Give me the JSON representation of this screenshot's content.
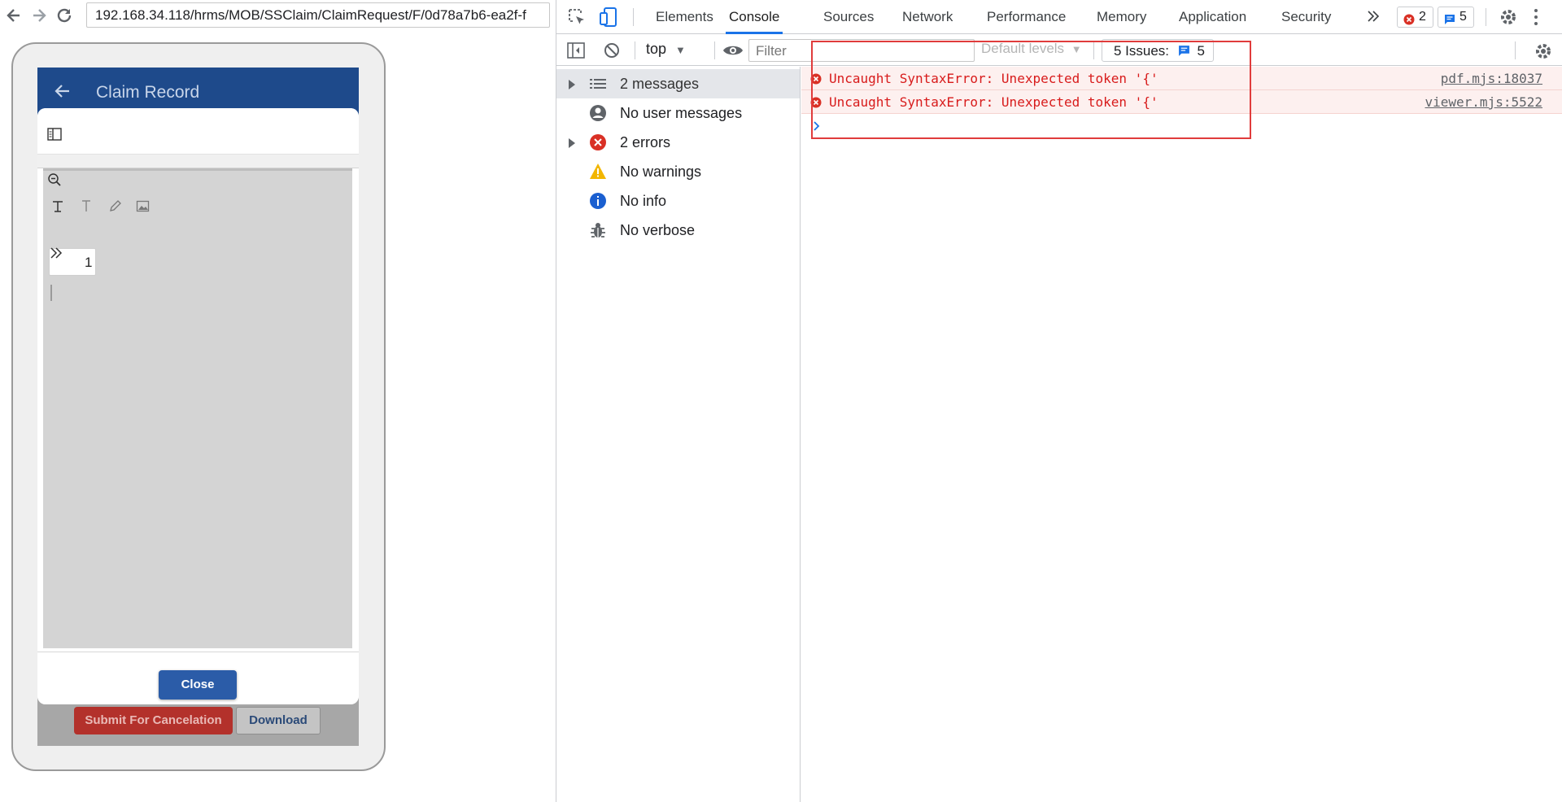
{
  "browser": {
    "url": "192.168.34.118/hrms/MOB/SSClaim/ClaimRequest/F/0d78a7b6-ea2f-f"
  },
  "app": {
    "title": "Claim Record",
    "pdf_page_number": "1",
    "close_label": "Close",
    "submit_cancel_label": "Submit For Cancelation",
    "download_label": "Download"
  },
  "devtools": {
    "tabs": [
      "Elements",
      "Console",
      "Sources",
      "Network",
      "Performance",
      "Memory",
      "Application",
      "Security"
    ],
    "active_tab": "Console",
    "error_badge": "2",
    "issue_badge": "5",
    "context": "top",
    "filter_placeholder": "Filter",
    "levels_label": "Default levels",
    "issues_label": "5 Issues:",
    "issues_count": "5",
    "sidebar": [
      {
        "label": "2 messages",
        "icon": "list-icon",
        "expandable": true,
        "selected": true
      },
      {
        "label": "No user messages",
        "icon": "user-icon",
        "expandable": false,
        "selected": false
      },
      {
        "label": "2 errors",
        "icon": "error-icon",
        "expandable": true,
        "selected": false
      },
      {
        "label": "No warnings",
        "icon": "warning-icon",
        "expandable": false,
        "selected": false
      },
      {
        "label": "No info",
        "icon": "info-icon",
        "expandable": false,
        "selected": false
      },
      {
        "label": "No verbose",
        "icon": "bug-icon",
        "expandable": false,
        "selected": false
      }
    ],
    "messages": [
      {
        "text": "Uncaught SyntaxError: Unexpected token '{'",
        "source": "pdf.mjs:18037"
      },
      {
        "text": "Uncaught SyntaxError: Unexpected token '{'",
        "source": "viewer.mjs:5522"
      }
    ],
    "colors": {
      "error": "#d81b1b",
      "accent": "#1a73e8",
      "highlight": "#e03c3c",
      "appbar": "#1e4a8b"
    }
  }
}
